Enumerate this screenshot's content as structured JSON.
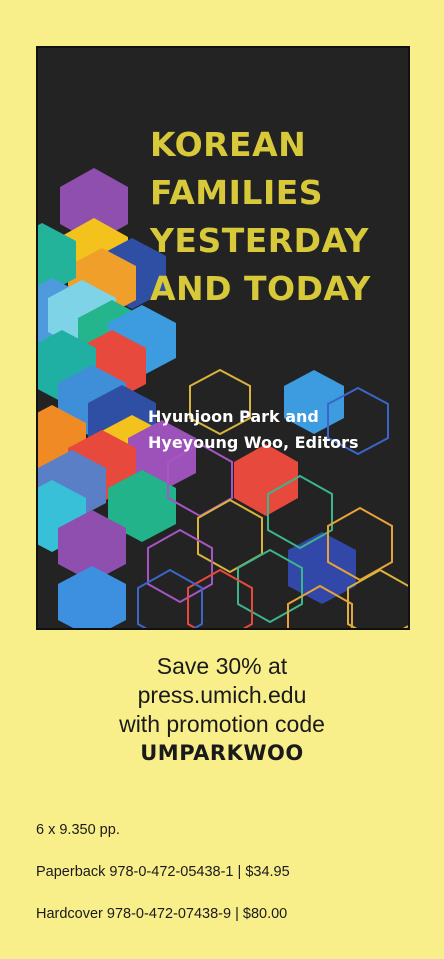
{
  "cover": {
    "title_lines": [
      "KOREAN",
      "FAMILIES",
      "YESTERDAY",
      "AND TODAY"
    ],
    "editors_lines": [
      "Hyunjoon Park and",
      "Hyeyoung Woo, Editors"
    ]
  },
  "promo": {
    "lines": [
      "Save 30% at",
      "press.umich.edu",
      "with promotion code"
    ],
    "code": "UMPARKWOO"
  },
  "details": {
    "dimensions": "6 x 9.350 pp.",
    "paperback": "Paperback 978-0-472-05438-1 | $34.95",
    "hardcover": "Hardcover 978-0-472-07438-9 | $80.00"
  },
  "colors": {
    "background": "#f9ef8a",
    "cover_background": "#232323",
    "title_yellow": "#d8c93a"
  }
}
